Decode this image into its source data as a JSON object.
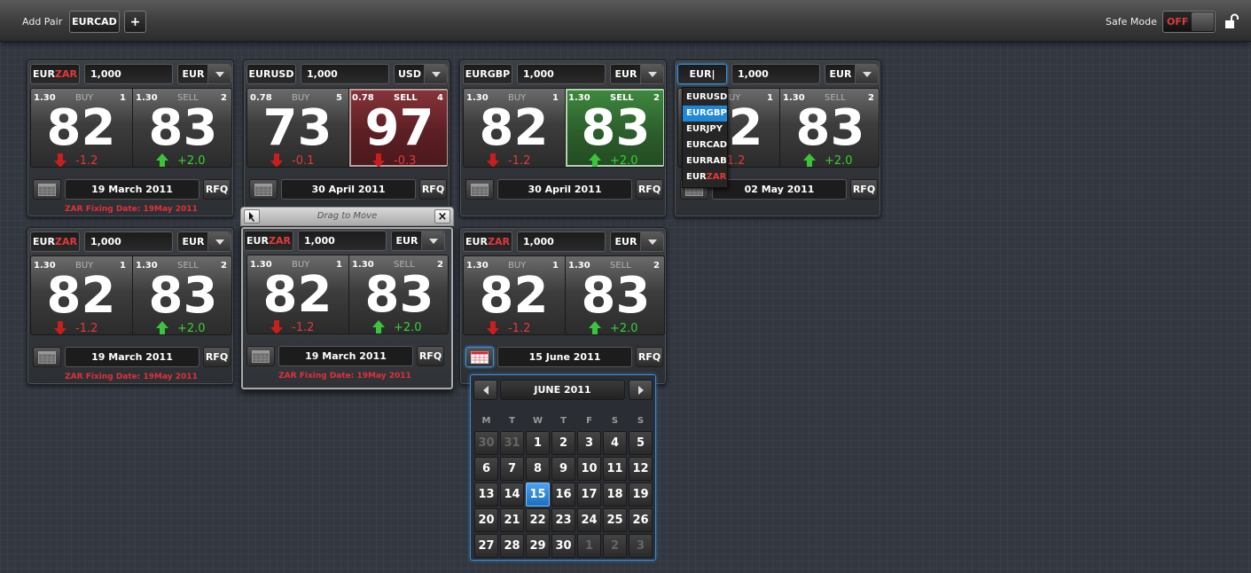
{
  "topbar": {
    "add_pair_label": "Add Pair",
    "pair_value": "EURCAD",
    "add_button": "+",
    "safe_mode_label": "Safe Mode",
    "safe_mode_state": "OFF"
  },
  "tiles": [
    {
      "pair_base": "EUR",
      "pair_quote": "ZAR",
      "amount": "1,000",
      "ccy": "EUR",
      "buy": {
        "pre": "1.30",
        "label": "BUY",
        "big": "82",
        "sup": "1",
        "chg": "-1.2"
      },
      "sell": {
        "pre": "1.30",
        "label": "SELL",
        "big": "83",
        "sup": "2",
        "chg": "+2.0"
      },
      "date": "19 March 2011",
      "rfq": "RFQ",
      "fixing": "ZAR Fixing Date: 19May 2011"
    },
    {
      "pair_base": "EURUSD",
      "pair_quote": "",
      "amount": "1,000",
      "ccy": "USD",
      "buy": {
        "pre": "0.78",
        "label": "BUY",
        "big": "73",
        "sup": "5",
        "chg": "-0.1"
      },
      "sell": {
        "pre": "0.78",
        "label": "SELL",
        "big": "97",
        "sup": "4",
        "chg": "-0.3"
      },
      "date": "30 April 2011",
      "rfq": "RFQ",
      "fixing": ""
    },
    {
      "pair_base": "EURGBP",
      "pair_quote": "",
      "amount": "1,000",
      "ccy": "EUR",
      "buy": {
        "pre": "1.30",
        "label": "BUY",
        "big": "82",
        "sup": "1",
        "chg": "-1.2"
      },
      "sell": {
        "pre": "1.30",
        "label": "SELL",
        "big": "83",
        "sup": "2",
        "chg": "+2.0"
      },
      "date": "30 April 2011",
      "rfq": "RFQ",
      "fixing": ""
    },
    {
      "pair_base": "EUR|",
      "pair_quote": "",
      "amount": "1,000",
      "ccy": "EUR",
      "buy": {
        "pre": "1.30",
        "label": "BUY",
        "big": "82",
        "sup": "1",
        "chg": "-1.2"
      },
      "sell": {
        "pre": "1.30",
        "label": "SELL",
        "big": "83",
        "sup": "2",
        "chg": "+2.0"
      },
      "date": "02 May 2011",
      "rfq": "RFQ",
      "fixing": ""
    },
    {
      "pair_base": "EUR",
      "pair_quote": "ZAR",
      "amount": "1,000",
      "ccy": "EUR",
      "buy": {
        "pre": "1.30",
        "label": "BUY",
        "big": "82",
        "sup": "1",
        "chg": "-1.2"
      },
      "sell": {
        "pre": "1.30",
        "label": "SELL",
        "big": "83",
        "sup": "2",
        "chg": "+2.0"
      },
      "date": "19 March 2011",
      "rfq": "RFQ",
      "fixing": "ZAR Fixing Date: 19May 2011"
    },
    {
      "pair_base": "EUR",
      "pair_quote": "ZAR",
      "amount": "1,000",
      "ccy": "EUR",
      "buy": {
        "pre": "1.30",
        "label": "BUY",
        "big": "82",
        "sup": "1",
        "chg": "-1.2"
      },
      "sell": {
        "pre": "1.30",
        "label": "SELL",
        "big": "83",
        "sup": "2",
        "chg": "+2.0"
      },
      "date": "19 March 2011",
      "rfq": "RFQ",
      "fixing": "ZAR Fixing Date: 19May 2011"
    },
    {
      "pair_base": "EUR",
      "pair_quote": "ZAR",
      "amount": "1,000",
      "ccy": "EUR",
      "buy": {
        "pre": "1.30",
        "label": "BUY",
        "big": "82",
        "sup": "1",
        "chg": "-1.2"
      },
      "sell": {
        "pre": "1.30",
        "label": "SELL",
        "big": "83",
        "sup": "2",
        "chg": "+2.0"
      },
      "date": "15 June 2011",
      "rfq": "RFQ",
      "fixing": ""
    }
  ],
  "dropdown": [
    {
      "base": "EURUSD",
      "quote": ""
    },
    {
      "base": "EURGBP",
      "quote": ""
    },
    {
      "base": "EURJPY",
      "quote": ""
    },
    {
      "base": "EURCAD",
      "quote": ""
    },
    {
      "base": "EURRAB",
      "quote": ""
    },
    {
      "base": "EUR",
      "quote": "ZAR"
    }
  ],
  "drag": {
    "title": "Drag to Move",
    "close": "×"
  },
  "calendar": {
    "month": "JUNE 2011",
    "dows": [
      "M",
      "T",
      "W",
      "T",
      "F",
      "S",
      "S"
    ],
    "days": [
      "30",
      "31",
      "1",
      "2",
      "3",
      "4",
      "5",
      "6",
      "7",
      "8",
      "9",
      "10",
      "11",
      "12",
      "13",
      "14",
      "15",
      "16",
      "17",
      "18",
      "19",
      "20",
      "21",
      "22",
      "23",
      "24",
      "25",
      "26",
      "27",
      "28",
      "29",
      "30",
      "1",
      "2",
      "3"
    ],
    "selected_day": "15"
  },
  "colors": {
    "accent": "#1e87d8",
    "negative": "#e23a3a",
    "positive": "#36d136"
  }
}
